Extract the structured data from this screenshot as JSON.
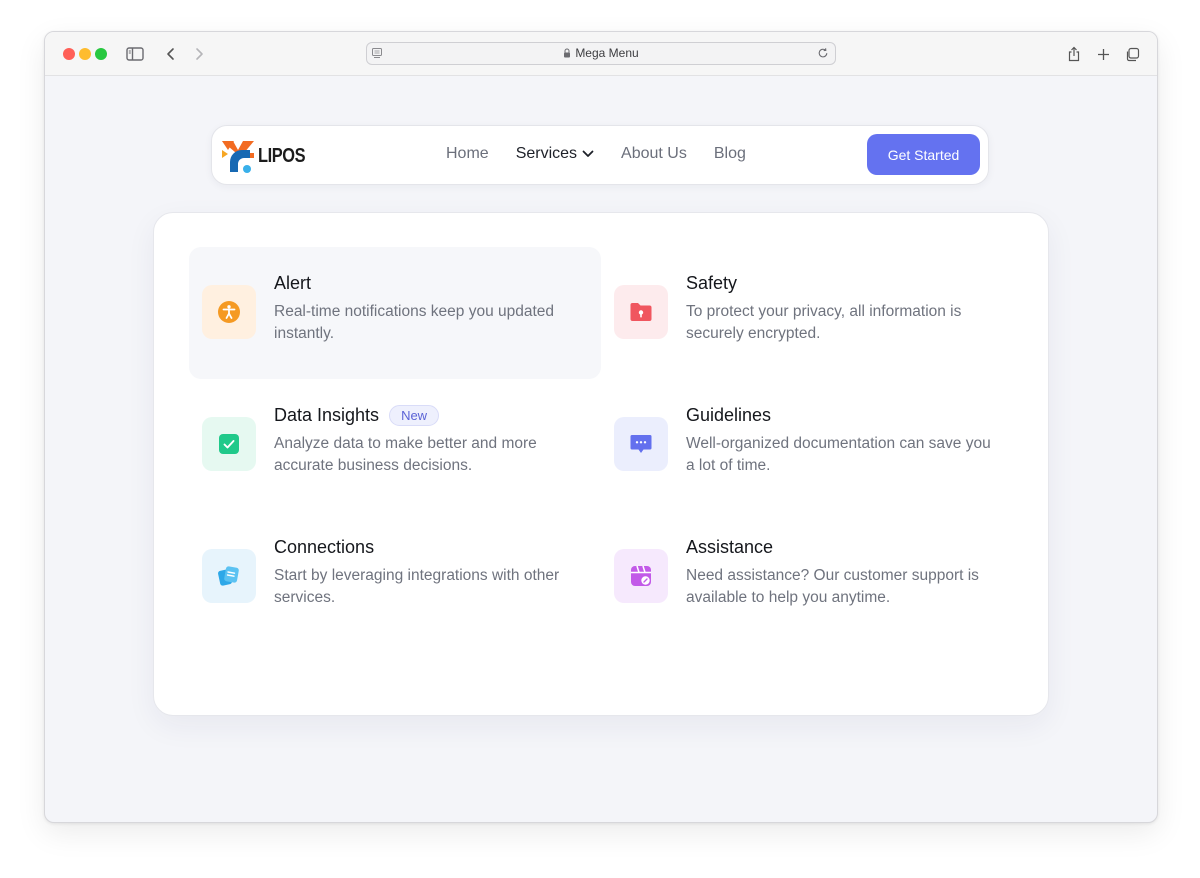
{
  "browser": {
    "url_title": "Mega Menu"
  },
  "navbar": {
    "logo_text": "LIPOS",
    "links": [
      {
        "label": "Home"
      },
      {
        "label": "Services"
      },
      {
        "label": "About Us"
      },
      {
        "label": "Blog"
      }
    ],
    "cta_label": "Get Started"
  },
  "menu": {
    "items": [
      {
        "title": "Alert",
        "description": "Real-time notifications keep you updated instantly.",
        "icon": "accessibility-icon",
        "color": "#f59a23",
        "bg": "#fff0e0"
      },
      {
        "title": "Safety",
        "description": "To protect your privacy, all information is securely encrypted.",
        "icon": "folder-lock-icon",
        "color": "#f0565f",
        "bg": "#fdebed"
      },
      {
        "title": "Data Insights",
        "badge": "New",
        "description": "Analyze data to make better and more accurate business decisions.",
        "icon": "checkbox-icon",
        "color": "#20c98a",
        "bg": "#e6f9f1"
      },
      {
        "title": "Guidelines",
        "description": "Well-organized documentation can save you a lot of time.",
        "icon": "chat-bubble-icon",
        "color": "#6370ee",
        "bg": "#ebeefd"
      },
      {
        "title": "Connections",
        "description": "Start by leveraging integrations with other services.",
        "icon": "cards-icon",
        "color": "#2ea8e8",
        "bg": "#e7f4fc"
      },
      {
        "title": "Assistance",
        "description": "Need assistance? Our customer support is available to help you anytime.",
        "icon": "calendar-edit-icon",
        "color": "#c25ae8",
        "bg": "#f6e9fd"
      }
    ]
  }
}
